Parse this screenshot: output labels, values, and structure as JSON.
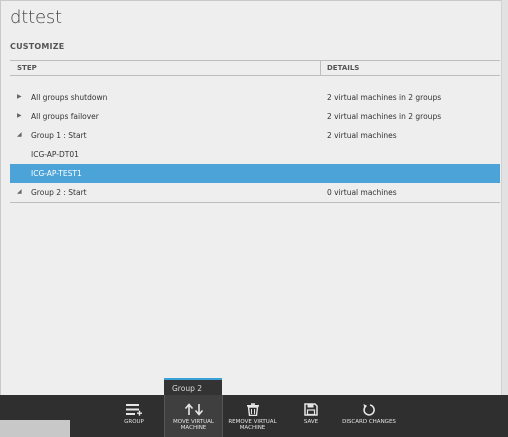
{
  "page": {
    "title": "dttest",
    "section": "CUSTOMIZE"
  },
  "table": {
    "headers": {
      "step": "STEP",
      "details": "DETAILS"
    },
    "rows": [
      {
        "arrow": "▶",
        "step": "All groups shutdown",
        "details": "2 virtual machines in 2 groups"
      },
      {
        "arrow": "▶",
        "step": "All groups failover",
        "details": "2 virtual machines in 2 groups"
      },
      {
        "arrow": "◢",
        "step": "Group 1 : Start",
        "details": "2 virtual machines"
      },
      {
        "step": "ICG-AP-DT01"
      },
      {
        "step": "ICG-AP-TEST1",
        "selected": true
      },
      {
        "arrow": "◢",
        "step": "Group 2 : Start",
        "details": "0 virtual machines"
      }
    ]
  },
  "popup": {
    "label": "Group 2"
  },
  "toolbar": {
    "group": "GROUP",
    "move_line1": "MOVE VIRTUAL",
    "move_line2": "MACHINE",
    "remove_line1": "REMOVE VIRTUAL",
    "remove_line2": "MACHINE",
    "save": "SAVE",
    "discard": "DISCARD CHANGES"
  },
  "icons": {
    "group": "list-add-icon",
    "move": "up-down-arrows-icon",
    "remove": "trash-icon",
    "save": "floppy-disk-icon",
    "discard": "undo-icon"
  },
  "colors": {
    "selected_row": "#4ba3d8",
    "toolbar": "#2f2f2f",
    "accent": "#3aa0d8"
  }
}
